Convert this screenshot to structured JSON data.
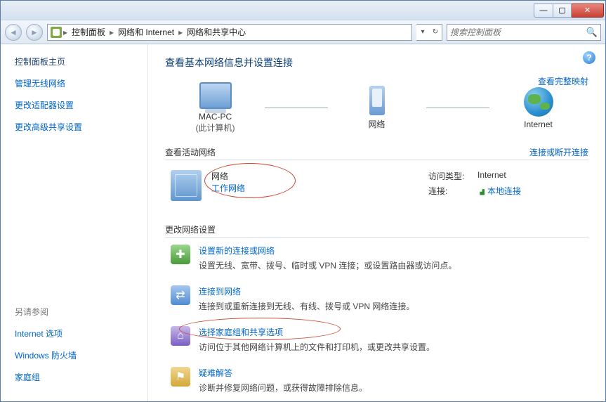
{
  "breadcrumb": {
    "items": [
      "控制面板",
      "网络和 Internet",
      "网络和共享中心"
    ]
  },
  "search": {
    "placeholder": "搜索控制面板"
  },
  "sidebar": {
    "home": "控制面板主页",
    "links": [
      "管理无线网络",
      "更改适配器设置",
      "更改高级共享设置"
    ],
    "see_also_title": "另请参阅",
    "see_also": [
      "Internet 选项",
      "Windows 防火墙",
      "家庭组"
    ]
  },
  "main": {
    "title": "查看基本网络信息并设置连接",
    "full_map": "查看完整映射",
    "nodes": {
      "computer": {
        "name": "MAC-PC",
        "sub": "(此计算机)"
      },
      "network": {
        "name": "网络"
      },
      "internet": {
        "name": "Internet"
      }
    },
    "active": {
      "header": "查看活动网络",
      "header_link": "连接或断开连接",
      "name": "网络",
      "type": "工作网络",
      "props": {
        "access_label": "访问类型:",
        "access_value": "Internet",
        "conn_label": "连接:",
        "conn_value": "本地连接"
      }
    },
    "change": {
      "header": "更改网络设置",
      "items": [
        {
          "title": "设置新的连接或网络",
          "desc": "设置无线、宽带、拨号、临时或 VPN 连接；或设置路由器或访问点。"
        },
        {
          "title": "连接到网络",
          "desc": "连接到或重新连接到无线、有线、拨号或 VPN 网络连接。"
        },
        {
          "title": "选择家庭组和共享选项",
          "desc": "访问位于其他网络计算机上的文件和打印机，或更改共享设置。"
        },
        {
          "title": "疑难解答",
          "desc": "诊断并修复网络问题，或获得故障排除信息。"
        }
      ]
    }
  }
}
